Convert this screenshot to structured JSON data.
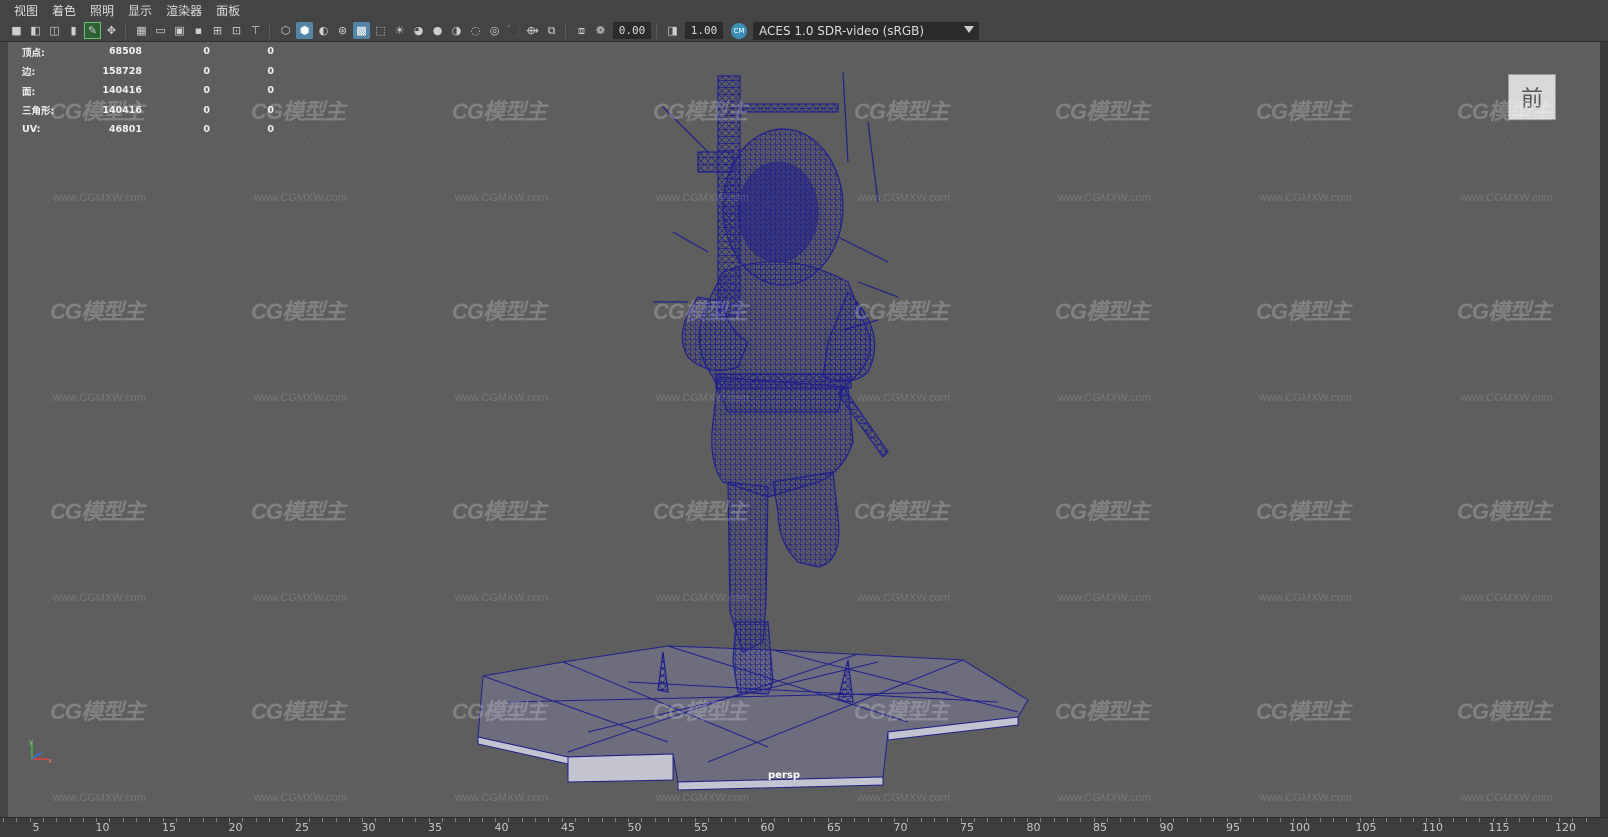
{
  "menu": [
    "视图",
    "着色",
    "照明",
    "显示",
    "渲染器",
    "面板"
  ],
  "toolbar": {
    "exposure": "0.00",
    "gamma": "1.00",
    "color_management_badge": "CM",
    "view_transform": "ACES 1.0 SDR-video (sRGB)",
    "icons": [
      "camera-icon",
      "camera-attr-icon",
      "bookmark-icon",
      "image-plane-icon",
      "grease-pencil-icon",
      "2d-pan-icon",
      "grid-icon",
      "film-gate-icon",
      "resolution-gate-icon",
      "gate-mask-icon",
      "field-chart-icon",
      "safe-action-icon",
      "safe-title-icon",
      "wireframe-icon",
      "smooth-shade-icon",
      "default-material-icon",
      "wireframe-on-shaded-icon",
      "xray-icon",
      "textured-icon",
      "lights-icon",
      "shadows-icon",
      "ambient-occlusion-icon",
      "motion-blur-icon",
      "antialias-icon",
      "depth-of-field-icon",
      "isolate-select-icon",
      "xray-joints-icon",
      "xray-active-icon",
      "backface-icon",
      "exposure-icon",
      "gamma-icon"
    ]
  },
  "hud": {
    "rows": [
      {
        "label": "顶点:",
        "v1": "68508",
        "v2": "0",
        "v3": "0"
      },
      {
        "label": "边:",
        "v1": "158728",
        "v2": "0",
        "v3": "0"
      },
      {
        "label": "面:",
        "v1": "140416",
        "v2": "0",
        "v3": "0"
      },
      {
        "label": "三角形:",
        "v1": "140416",
        "v2": "0",
        "v3": "0"
      },
      {
        "label": "UV:",
        "v1": "46801",
        "v2": "0",
        "v3": "0"
      }
    ]
  },
  "viewcube_label": "前",
  "camera_label": "persp",
  "watermark": {
    "logo": "CG模型主",
    "url": "www.CGMXW.com"
  },
  "colors": {
    "viewport_bg": "#5e5e5e",
    "wireframe": "#1f1f8c",
    "ui_bg": "#444444",
    "accent": "#5285a6"
  },
  "timeline": {
    "ticks": [
      "5",
      "10",
      "15",
      "20",
      "25",
      "30",
      "35",
      "40",
      "45",
      "50",
      "55",
      "60",
      "65",
      "70",
      "75",
      "80",
      "85",
      "90",
      "95",
      "100",
      "105",
      "110",
      "115",
      "120"
    ]
  }
}
